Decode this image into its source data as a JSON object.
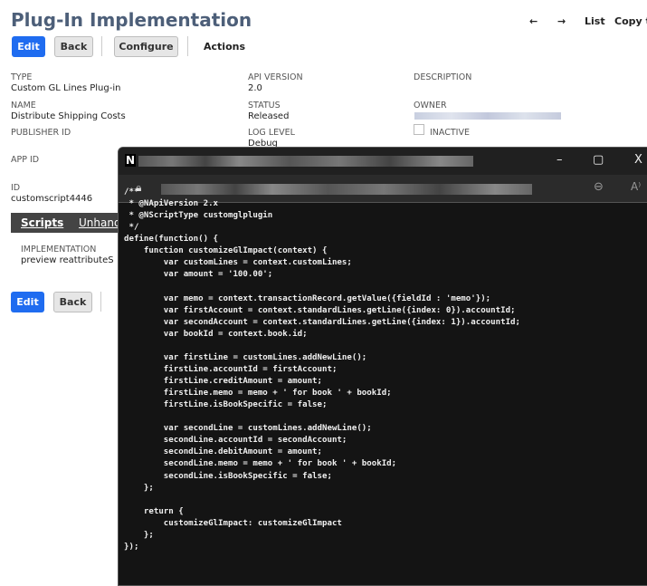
{
  "header": {
    "title": "Plug-In Implementation",
    "back_arrow": "←",
    "forward_arrow": "→",
    "list": "List",
    "copy": "Copy t"
  },
  "toolbar": {
    "edit": "Edit",
    "back": "Back",
    "configure": "Configure",
    "actions": "Actions"
  },
  "fields": {
    "type_label": "TYPE",
    "type": "Custom GL Lines Plug-in",
    "api_label": "API VERSION",
    "api": "2.0",
    "desc_label": "DESCRIPTION",
    "name_label": "NAME",
    "name": "Distribute Shipping Costs",
    "status_label": "STATUS",
    "status": "Released",
    "owner_label": "OWNER",
    "publisher_label": "PUBLISHER ID",
    "log_label": "LOG LEVEL",
    "log": "Debug",
    "inactive_label": "INACTIVE",
    "appid_label": "APP ID",
    "id_label": "ID",
    "id": "customscript4446"
  },
  "tabs": {
    "scripts": "Scripts",
    "unhandled": "Unhand"
  },
  "impl": {
    "label": "IMPLEMENTATION",
    "value": "preview reattributeS"
  },
  "bottom": {
    "edit": "Edit",
    "back": "Back"
  },
  "popup": {
    "logo": "N",
    "minimize": "–",
    "maximize": "▢",
    "close": "X",
    "read_aloud": "A⁾",
    "code": "/**\n * @NApiVersion 2.x\n * @NScriptType customglplugin\n */\ndefine(function() {\n    function customizeGlImpact(context) {\n        var customLines = context.customLines;\n        var amount = '100.00';\n\n        var memo = context.transactionRecord.getValue({fieldId : 'memo'});\n        var firstAccount = context.standardLines.getLine({index: 0}).accountId;\n        var secondAccount = context.standardLines.getLine({index: 1}).accountId;\n        var bookId = context.book.id;\n\n        var firstLine = customLines.addNewLine();\n        firstLine.accountId = firstAccount;\n        firstLine.creditAmount = amount;\n        firstLine.memo = memo + ' for book ' + bookId;\n        firstLine.isBookSpecific = false;\n\n        var secondLine = customLines.addNewLine();\n        secondLine.accountId = secondAccount;\n        secondLine.debitAmount = amount;\n        secondLine.memo = memo + ' for book ' + bookId;\n        secondLine.isBookSpecific = false;\n    };\n\n    return {\n        customizeGlImpact: customizeGlImpact\n    };\n});"
  }
}
